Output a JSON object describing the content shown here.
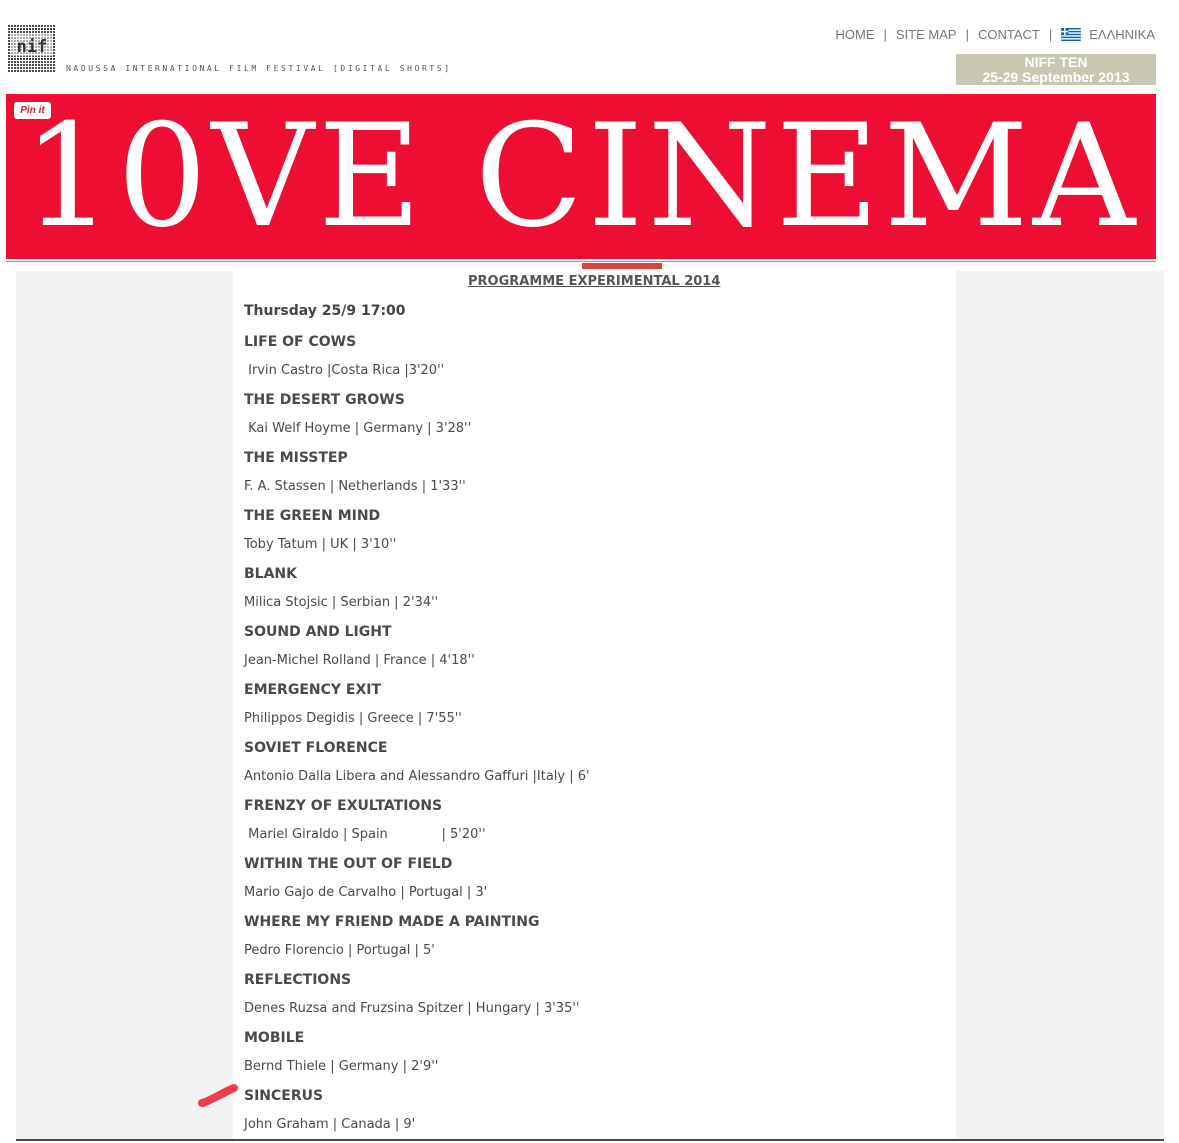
{
  "header": {
    "tagline": "NAOUSSA INTERNATIONAL FILM FESTIVAL [DIGITAL SHORTS]",
    "nav": [
      {
        "label": "HOME"
      },
      {
        "label": "SITE MAP"
      },
      {
        "label": "CONTACT"
      },
      {
        "label": "ΕΛΛΗΝΙΚΑ"
      }
    ],
    "badge": {
      "line1": "NIFF TEN",
      "line2": "25-29 September 2013"
    },
    "banner_title": "10VE CINEMA",
    "pinit_label": "Pin it",
    "banner_color": "#ee0e32"
  },
  "programme": {
    "title": "PROGRAMME EXPERIMENTAL 2014",
    "day": "Thursday 25/9 17:00",
    "films": [
      {
        "title": "LIFE OF COWS",
        "info": " Irvin Castro |Costa Rica |3'20''"
      },
      {
        "title": "THE DESERT GROWS",
        "info": " Kai Welf Hoyme | Germany | 3'28''"
      },
      {
        "title": "THE MISSTEP",
        "info": "F. A. Stassen | Netherlands | 1'33''"
      },
      {
        "title": "THE GREEN MIND",
        "info": "Toby Tatum | UK | 3'10''"
      },
      {
        "title": "BLANK",
        "info": "Milica Stojsic | Serbian | 2'34''"
      },
      {
        "title": "SOUND AND LIGHT",
        "info": "Jean-Michel Rolland | France | 4'18''"
      },
      {
        "title": "EMERGENCY EXIT",
        "info": "Philippos Degidis | Greece | 7'55''"
      },
      {
        "title": "SOVIET FLORENCE",
        "info": "Antonio Dalla Libera and Alessandro Gaffuri |Italy | 6'"
      },
      {
        "title": "FRENZY OF EXULTATIONS",
        "info": " Mariel Giraldo | Spain             | 5'20''"
      },
      {
        "title": "WITHIN THE OUT OF FIELD",
        "info": "Mario Gajo de Carvalho | Portugal | 3'"
      },
      {
        "title": "WHERE MY FRIEND MADE A PAINTING",
        "info": "Pedro Florencio | Portugal | 5'"
      },
      {
        "title": "REFLECTIONS",
        "info": "Denes Ruzsa and Fruzsina Spitzer | Hungary | 3'35''"
      },
      {
        "title": "MOBILE",
        "info": "Bernd Thiele | Germany | 2'9''"
      },
      {
        "title": "SINCERUS",
        "info": "John Graham | Canada | 9'"
      }
    ]
  }
}
